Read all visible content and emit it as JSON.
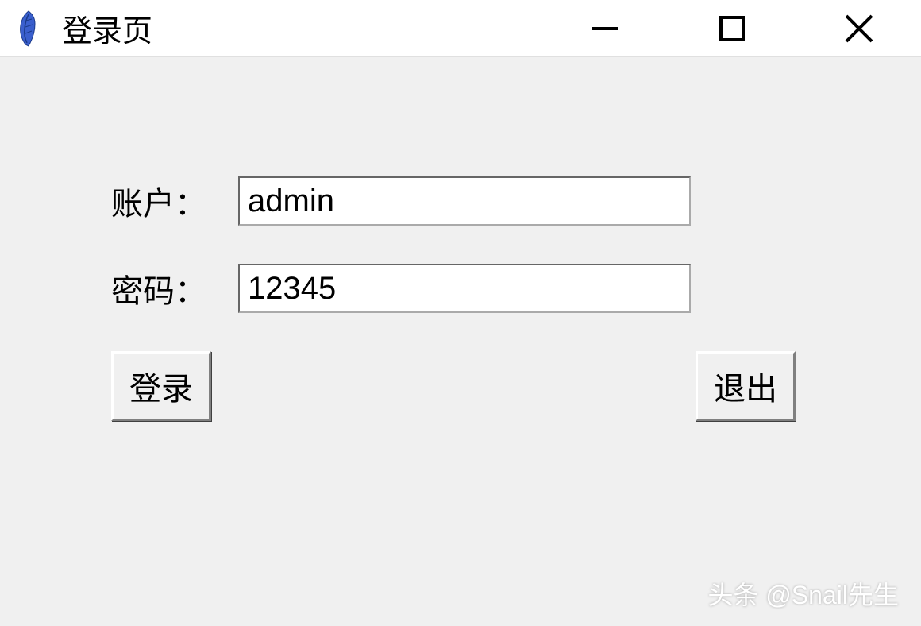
{
  "window": {
    "title": "登录页"
  },
  "form": {
    "account": {
      "label": "账户：",
      "value": "admin"
    },
    "password": {
      "label": "密码：",
      "value": "12345"
    }
  },
  "buttons": {
    "login": "登录",
    "exit": "退出"
  },
  "watermark": "头条 @Snail先生"
}
